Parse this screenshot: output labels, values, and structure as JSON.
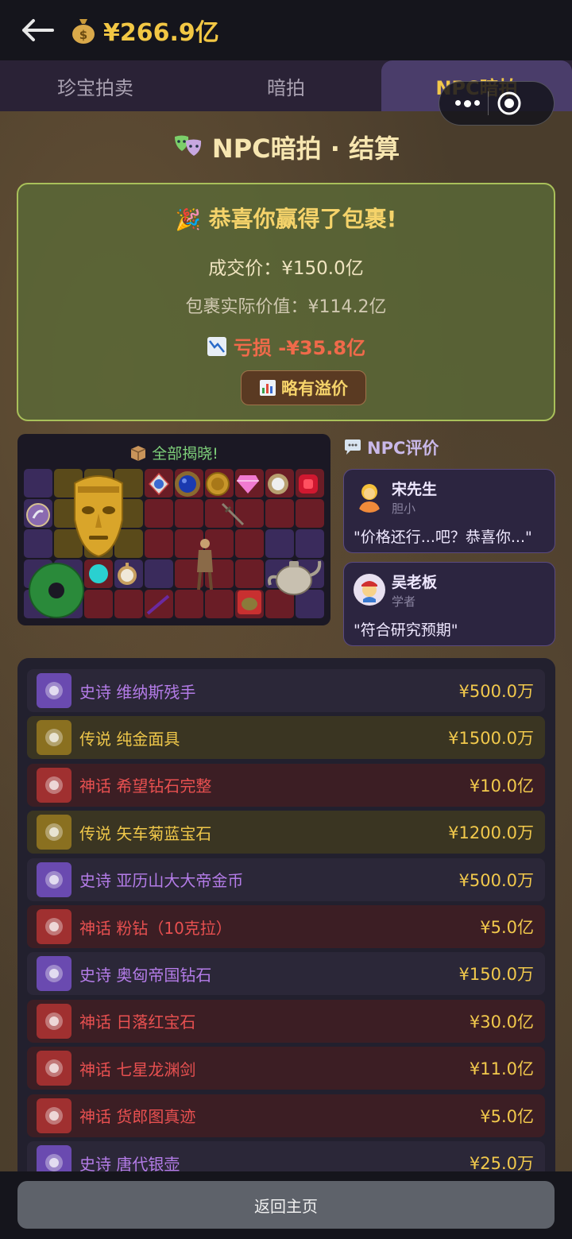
{
  "header": {
    "money": "¥266.9亿"
  },
  "tabs": [
    {
      "label": "珍宝拍卖"
    },
    {
      "label": "暗拍"
    },
    {
      "label": "NPC暗拍"
    }
  ],
  "page_title": "NPC暗拍 · 结算",
  "result": {
    "headline": "恭喜你赢得了包裹!",
    "deal_price": "成交价：¥150.0亿",
    "real_value": "包裹实际价值：¥114.2亿",
    "loss": "亏损 -¥35.8亿",
    "badge": "略有溢价"
  },
  "reveal": {
    "label": "全部揭晓!"
  },
  "npc_section": {
    "title": "NPC评价",
    "npcs": [
      {
        "name": "宋先生",
        "tag": "胆小",
        "comment": "\"价格还行...吧？恭喜你...\""
      },
      {
        "name": "吴老板",
        "tag": "学者",
        "comment": "\"符合研究预期\""
      }
    ]
  },
  "items": [
    {
      "rarity": "epic",
      "name": "史诗 维纳斯残手",
      "price": "¥500.0万",
      "icon": "venus-hand-icon"
    },
    {
      "rarity": "legendary",
      "name": "传说 纯金面具",
      "price": "¥1500.0万",
      "icon": "gold-mask-icon"
    },
    {
      "rarity": "mythic",
      "name": "神话 希望钻石完整",
      "price": "¥10.0亿",
      "icon": "hope-diamond-icon"
    },
    {
      "rarity": "legendary",
      "name": "传说 矢车菊蓝宝石",
      "price": "¥1200.0万",
      "icon": "sapphire-icon"
    },
    {
      "rarity": "epic",
      "name": "史诗 亚历山大大帝金币",
      "price": "¥500.0万",
      "icon": "gold-coin-icon"
    },
    {
      "rarity": "mythic",
      "name": "神话 粉钻（10克拉）",
      "price": "¥5.0亿",
      "icon": "pink-diamond-icon"
    },
    {
      "rarity": "epic",
      "name": "史诗 奥匈帝国钻石",
      "price": "¥150.0万",
      "icon": "diamond-brooch-icon"
    },
    {
      "rarity": "mythic",
      "name": "神话 日落红宝石",
      "price": "¥30.0亿",
      "icon": "ruby-icon"
    },
    {
      "rarity": "mythic",
      "name": "神话 七星龙渊剑",
      "price": "¥11.0亿",
      "icon": "sword-icon"
    },
    {
      "rarity": "mythic",
      "name": "神话 货郎图真迹",
      "price": "¥5.0亿",
      "icon": "painting-icon"
    },
    {
      "rarity": "epic",
      "name": "史诗 唐代银壶",
      "price": "¥25.0万",
      "icon": "silver-teapot-icon"
    }
  ],
  "footer": {
    "home_label": "返回主页"
  },
  "colors": {
    "gold": "#f2c744",
    "epic": "#b47ce8",
    "legendary": "#f0c84a",
    "mythic": "#e85050",
    "win_border": "#a9c05a"
  }
}
